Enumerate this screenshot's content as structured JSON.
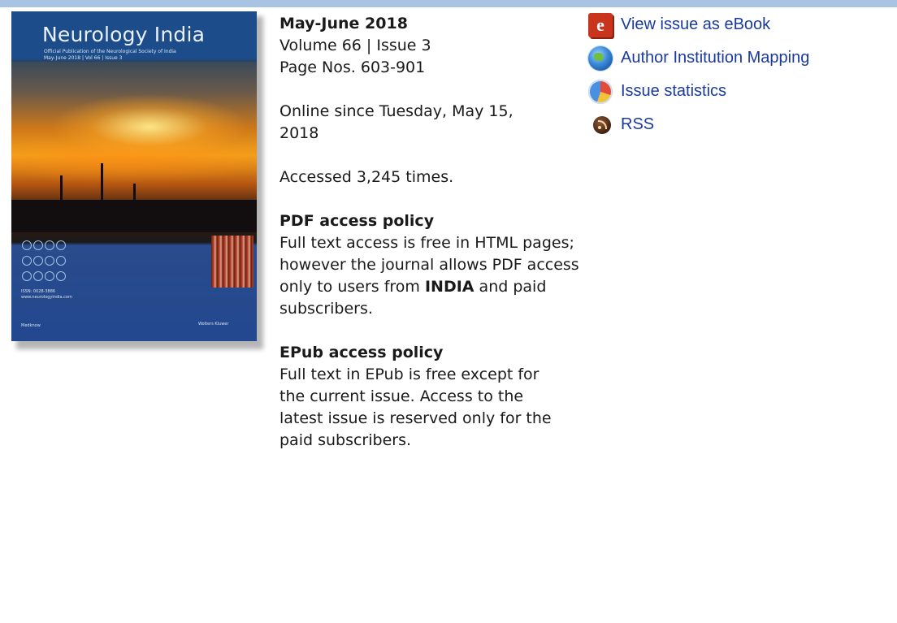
{
  "cover": {
    "title": "Neurology India",
    "subtitle_line1": "Official Publication of the Neurological Society of India",
    "subtitle_line2": "May-June 2018 | Vol 66 | Issue 3",
    "issn": "ISSN: 0028-3886",
    "website": "www.neurologyindia.com",
    "footer_left": "Medknow",
    "footer_right": "Wolters Kluwer"
  },
  "issue": {
    "date": "May-June 2018",
    "volume_issue": "Volume 66 | Issue 3",
    "pages": "Page Nos. 603-901",
    "online_since": "Online since Tuesday, May 15, 2018",
    "accessed": "Accessed 3,245 times."
  },
  "pdf_policy": {
    "heading": "PDF access policy",
    "text_before": "Full text access is free in HTML pages; however the journal allows PDF access only to users from ",
    "country": "INDIA",
    "text_after": " and paid subscribers."
  },
  "epub_policy": {
    "heading": "EPub access policy",
    "text": "Full text in EPub is free except for the current issue. Access to the latest issue is reserved only for the paid subscribers."
  },
  "links": [
    {
      "label": "View issue as eBook",
      "icon": "ebook-icon"
    },
    {
      "label": "Author Institution Mapping",
      "icon": "globe-icon"
    },
    {
      "label": "Issue statistics",
      "icon": "pie-chart-icon"
    },
    {
      "label": "RSS",
      "icon": "rss-icon"
    }
  ],
  "colors": {
    "top_bar": "#a9c4e2",
    "link": "#1a3aa0",
    "text": "#1a1a1a"
  }
}
